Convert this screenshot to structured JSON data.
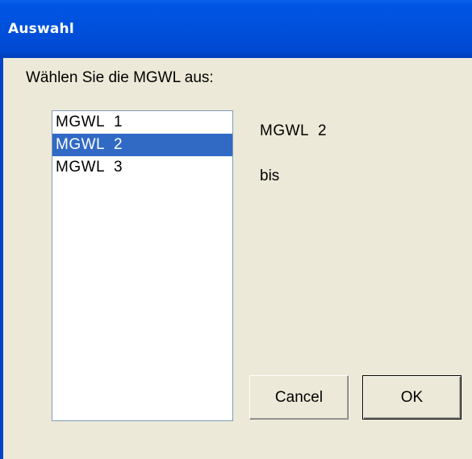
{
  "window": {
    "title": "Auswahl"
  },
  "prompt": "Wählen Sie die MGWL aus:",
  "list": {
    "items": [
      "MGWL  1",
      "MGWL  2",
      "MGWL  3"
    ],
    "selected_index": 1
  },
  "selection_label": "MGWL  2",
  "bis_label": "bis",
  "buttons": {
    "cancel": "Cancel",
    "ok": "OK"
  },
  "colors": {
    "titlebar": "#0054E3",
    "selection": "#316AC5",
    "dialog_bg": "#ECE9D8"
  }
}
